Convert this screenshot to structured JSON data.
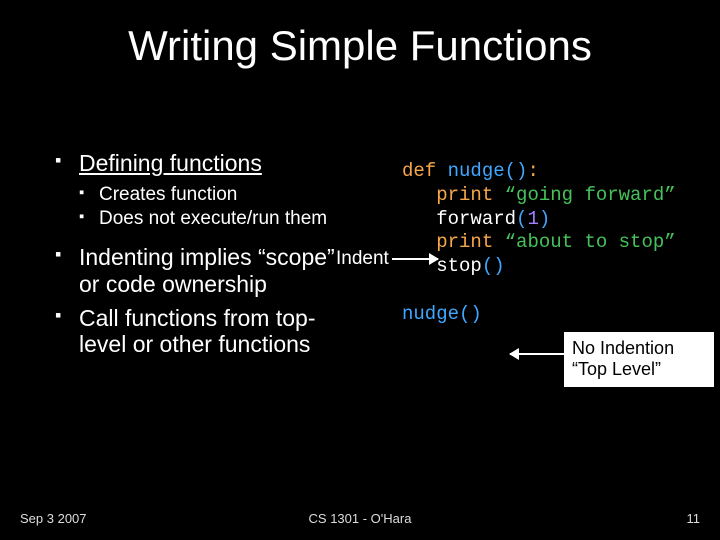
{
  "title": "Writing Simple Functions",
  "bullets": {
    "b1": "Defining functions",
    "b1a": "Creates function",
    "b1b": "Does not execute/run them",
    "b2": "Indenting implies “scope” or code ownership",
    "b3": "Call functions from top-level or other functions"
  },
  "labels": {
    "indent": "Indent",
    "callout1": "No Indention",
    "callout2": "“Top Level”"
  },
  "code": {
    "def": "def",
    "fn_nudge": "nudge",
    "lp": "(",
    "rp": ")",
    "colon": ":",
    "print1": "print",
    "str1": "“going forward”",
    "fwd": "forward",
    "one": "1",
    "print2": "print",
    "str2": "“about to stop”",
    "stop": "stop",
    "call_nudge": "nudge"
  },
  "footer": {
    "date": "Sep 3 2007",
    "center": "CS 1301 - O'Hara",
    "page": "11"
  }
}
